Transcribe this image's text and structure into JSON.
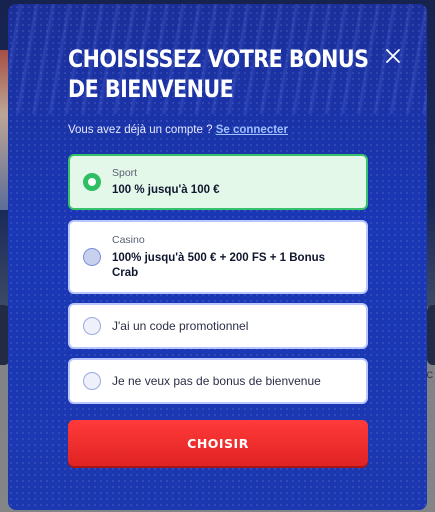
{
  "modal": {
    "title_line1": "CHOISISSEZ VOTRE BONUS",
    "title_line2": "DE BIENVENUE",
    "account_prompt": "Vous avez déjà un compte ?",
    "login_link": "Se connecter",
    "options": [
      {
        "category": "Sport",
        "text": "100 % jusqu'à 100 €",
        "selected": true
      },
      {
        "category": "Casino",
        "text": "100% jusqu'à 500 € + 200 FS + 1 Bonus Crab",
        "selected": false
      },
      {
        "text": "J'ai un code promotionnel",
        "selected": false
      },
      {
        "text": "Je ne veux pas de bonus de bienvenue",
        "selected": false
      }
    ],
    "choose_button": "CHOISIR"
  },
  "background": {
    "right_edge_text": "C"
  },
  "colors": {
    "modal_bg": "#1934a8",
    "selected_green": "#2fbf63",
    "button_red": "#ff3a3a"
  }
}
